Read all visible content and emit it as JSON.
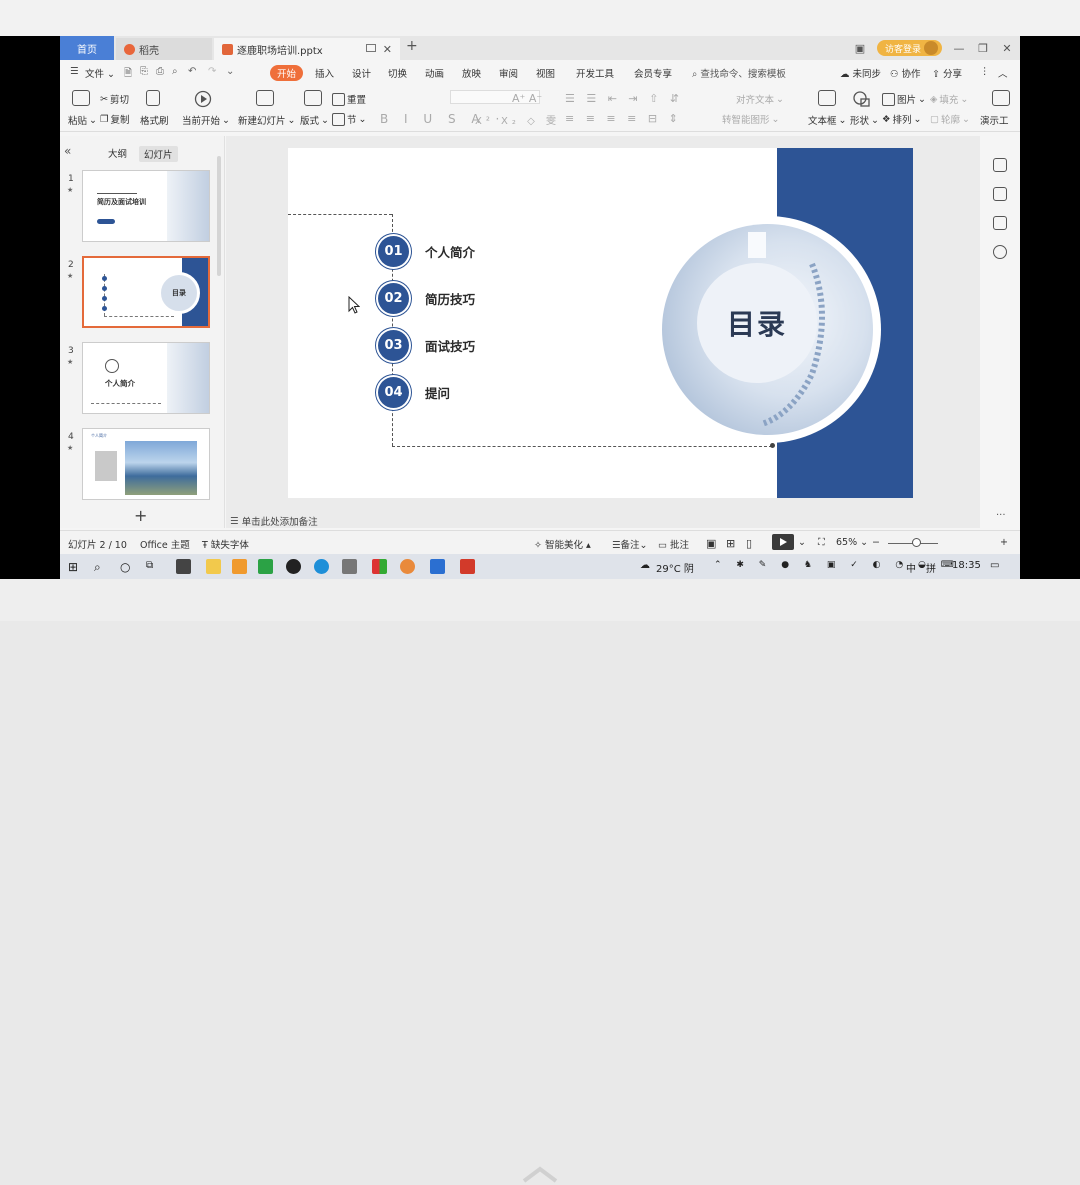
{
  "tabs": {
    "home": "首页",
    "daoke": "稻壳",
    "file": "逐鹿职场培训.pptx",
    "guest_login": "访客登录"
  },
  "menu": {
    "file": "文件",
    "items": [
      "开始",
      "插入",
      "设计",
      "切换",
      "动画",
      "放映",
      "审阅",
      "视图",
      "开发工具",
      "会员专享"
    ],
    "search": "查找命令、搜索模板",
    "unsync": "未同步",
    "collab": "协作",
    "share": "分享"
  },
  "ribbon": {
    "paste": "粘贴",
    "cut": "剪切",
    "copy": "复制",
    "format_painter": "格式刷",
    "from_current": "当前开始",
    "new_slide": "新建幻灯片",
    "layout": "版式",
    "section": "节",
    "reset": "重置",
    "align_text": "对齐文本",
    "smartart": "转智能图形",
    "textbox": "文本框",
    "shape": "形状",
    "picture": "图片",
    "arrange": "排列",
    "fill": "填充",
    "outline": "轮廓",
    "presenter": "演示工"
  },
  "leftpane": {
    "outline_tab": "大纲",
    "slides_tab": "幻灯片",
    "thumbs": [
      {
        "num": "1",
        "title": "简历及面试培训"
      },
      {
        "num": "2",
        "title": "目录"
      },
      {
        "num": "3",
        "title": "个人简介"
      },
      {
        "num": "4",
        "title": "个人简介"
      }
    ]
  },
  "slide": {
    "heading": "目录",
    "items": [
      {
        "num": "01",
        "label": "个人简介"
      },
      {
        "num": "02",
        "label": "简历技巧"
      },
      {
        "num": "03",
        "label": "面试技巧"
      },
      {
        "num": "04",
        "label": "提问"
      }
    ]
  },
  "notes_placeholder": "单击此处添加备注",
  "status": {
    "slide_of": "幻灯片 2 / 10",
    "theme": "Office 主题",
    "missing_font": "缺失字体",
    "smart_beautify": "智能美化",
    "notes": "备注",
    "comments": "批注",
    "zoom": "65%"
  },
  "taskbar": {
    "weather": "29°C 阴",
    "ime": "中",
    "ime2": "拼",
    "time": "18:35"
  },
  "colors": {
    "accent": "#2d5495",
    "start_tab": "#ef6f3a",
    "home_tab": "#4a7fd6",
    "selected_thumb": "#e46a3a"
  }
}
